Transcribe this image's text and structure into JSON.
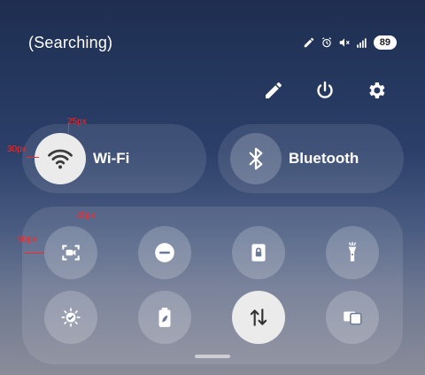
{
  "status_bar": {
    "network_status": "(Searching)",
    "battery_level": "89"
  },
  "quick_actions": {
    "edit": "edit-icon",
    "power": "power-icon",
    "settings": "gear-icon"
  },
  "tiles_top": {
    "wifi": {
      "label": "Wi-Fi",
      "active": true
    },
    "bluetooth": {
      "label": "Bluetooth",
      "active": false
    }
  },
  "tiles_grid": [
    {
      "icon": "screen-record-icon",
      "active": false
    },
    {
      "icon": "do-not-disturb-icon",
      "active": false
    },
    {
      "icon": "lock-screen-icon",
      "active": false
    },
    {
      "icon": "flashlight-icon",
      "active": false
    },
    {
      "icon": "eye-comfort-icon",
      "active": false
    },
    {
      "icon": "battery-saver-icon",
      "active": false
    },
    {
      "icon": "mobile-data-icon",
      "active": true
    },
    {
      "icon": "cast-icon",
      "active": false
    }
  ],
  "annotations": {
    "a1": "25px",
    "a2": "30px",
    "a3": "45px",
    "a4": "50px"
  }
}
